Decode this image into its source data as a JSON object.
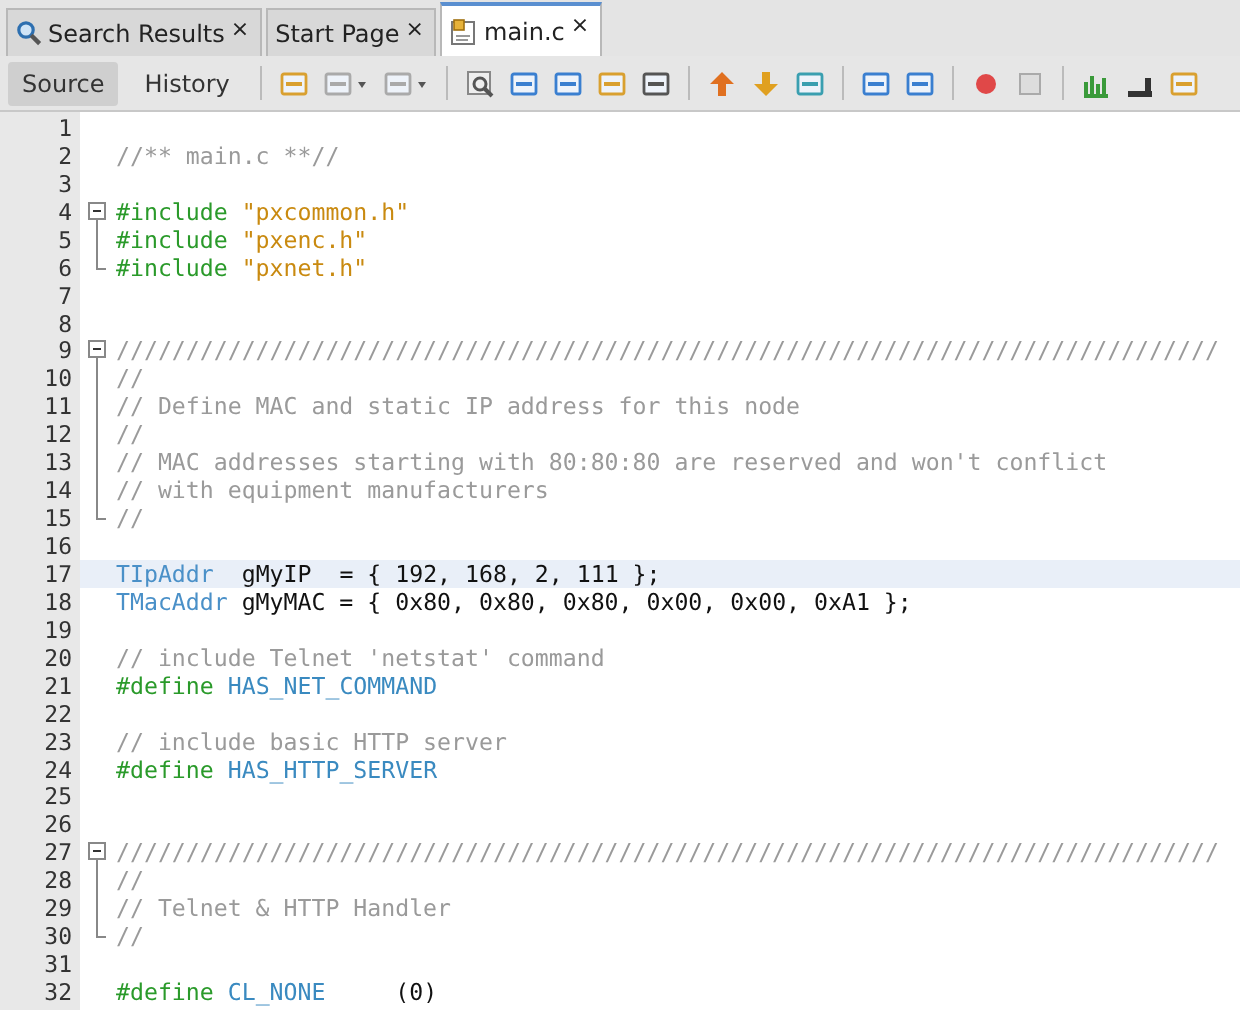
{
  "tabs": [
    {
      "label": "Search Results",
      "selected": false,
      "close": "×"
    },
    {
      "label": "Start Page",
      "selected": false,
      "close": "×"
    },
    {
      "label": "main.c",
      "selected": true,
      "close": "×"
    }
  ],
  "view_buttons": [
    {
      "label": "Source",
      "selected": true
    },
    {
      "label": "History",
      "selected": false
    }
  ],
  "editor": {
    "lines": [
      {
        "number": "1"
      },
      {
        "number": "2",
        "tokens": [
          {
            "kind": "comment",
            "text": "//** main.c **//"
          }
        ]
      },
      {
        "number": "3"
      },
      {
        "number": "4",
        "expanded": true,
        "tokens": [
          {
            "kind": "directive",
            "text": "#include"
          },
          {
            "kind": "string",
            "text": " \"pxcommon.h\""
          }
        ]
      },
      {
        "number": "5",
        "tokens": [
          {
            "kind": "directive",
            "text": "#include"
          },
          {
            "kind": "string",
            "text": " \"pxenc.h\""
          }
        ]
      },
      {
        "number": "6",
        "fold_end": true,
        "tokens": [
          {
            "kind": "directive",
            "text": "#include"
          },
          {
            "kind": "string",
            "text": " \"pxnet.h\""
          }
        ]
      },
      {
        "number": "7"
      },
      {
        "number": "8"
      },
      {
        "number": "9",
        "expanded": true,
        "tokens": [
          {
            "kind": "comment",
            "text": "///////////////////////////////////////////////////////////////////////////////"
          }
        ]
      },
      {
        "number": "10",
        "tokens": [
          {
            "kind": "comment",
            "text": "//"
          }
        ]
      },
      {
        "number": "11",
        "tokens": [
          {
            "kind": "comment",
            "text": "// Define MAC and static IP address for this node"
          }
        ]
      },
      {
        "number": "12",
        "tokens": [
          {
            "kind": "comment",
            "text": "//"
          }
        ]
      },
      {
        "number": "13",
        "tokens": [
          {
            "kind": "comment",
            "text": "// MAC addresses starting with 80:80:80 are reserved and won't conflict"
          }
        ]
      },
      {
        "number": "14",
        "tokens": [
          {
            "kind": "comment",
            "text": "// with equipment manufacturers"
          }
        ]
      },
      {
        "number": "15",
        "fold_end": true,
        "tokens": [
          {
            "kind": "comment",
            "text": "//"
          }
        ]
      },
      {
        "number": "16"
      },
      {
        "number": "17",
        "current": true,
        "tokens": [
          {
            "kind": "type",
            "text": "TIpAddr"
          },
          {
            "kind": "plain",
            "text": "  gMyIP  = { 192, 168, 2, 111 };"
          }
        ]
      },
      {
        "number": "18",
        "tokens": [
          {
            "kind": "type",
            "text": "TMacAddr"
          },
          {
            "kind": "plain",
            "text": " gMyMAC = { 0x80, 0x80, 0x80, 0x00, 0x00, 0xA1 };"
          }
        ]
      },
      {
        "number": "19"
      },
      {
        "number": "20",
        "tokens": [
          {
            "kind": "comment",
            "text": "// include Telnet 'netstat' command"
          }
        ]
      },
      {
        "number": "21",
        "tokens": [
          {
            "kind": "directive",
            "text": "#define"
          },
          {
            "kind": "macro",
            "text": " HAS_NET_COMMAND"
          }
        ]
      },
      {
        "number": "22"
      },
      {
        "number": "23",
        "tokens": [
          {
            "kind": "comment",
            "text": "// include basic HTTP server"
          }
        ]
      },
      {
        "number": "24",
        "tokens": [
          {
            "kind": "directive",
            "text": "#define"
          },
          {
            "kind": "macro",
            "text": " HAS_HTTP_SERVER"
          }
        ]
      },
      {
        "number": "25"
      },
      {
        "number": "26"
      },
      {
        "number": "27",
        "expanded": true,
        "tokens": [
          {
            "kind": "comment",
            "text": "///////////////////////////////////////////////////////////////////////////////"
          }
        ]
      },
      {
        "number": "28",
        "tokens": [
          {
            "kind": "comment",
            "text": "//"
          }
        ]
      },
      {
        "number": "29",
        "tokens": [
          {
            "kind": "comment",
            "text": "// Telnet & HTTP Handler"
          }
        ]
      },
      {
        "number": "30",
        "fold_end": true,
        "tokens": [
          {
            "kind": "comment",
            "text": "//"
          }
        ]
      },
      {
        "number": "31"
      },
      {
        "number": "32",
        "tokens": [
          {
            "kind": "directive",
            "text": "#define"
          },
          {
            "kind": "macro",
            "text": " CL_NONE"
          },
          {
            "kind": "plain",
            "text": "     (0)"
          }
        ]
      }
    ]
  }
}
